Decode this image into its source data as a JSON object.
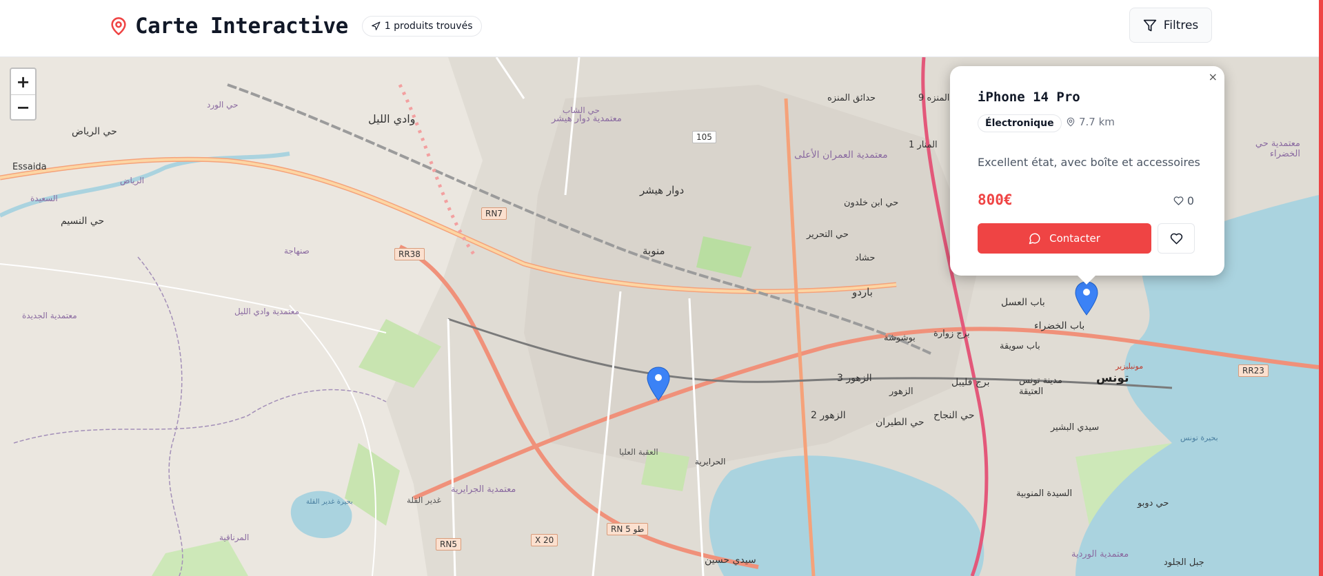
{
  "header": {
    "title": "Carte Interactive",
    "results_badge": "1 produits trouvés",
    "filters_label": "Filtres"
  },
  "map": {
    "zoom_in": "+",
    "zoom_out": "−",
    "place_labels": [
      {
        "text": "Essaida"
      },
      {
        "text": "حي الرياض"
      },
      {
        "text": "وادي الليل"
      },
      {
        "text": "الرياض"
      },
      {
        "text": "السعيدة"
      },
      {
        "text": "حي النسيم"
      },
      {
        "text": "صنهاجة"
      },
      {
        "text": "معتمدية الجديدة"
      },
      {
        "text": "معتمدية وادي الليل"
      },
      {
        "text": "دوار هيشر"
      },
      {
        "text": "معتمدية دوار هيشر"
      },
      {
        "text": "منوبة"
      },
      {
        "text": "العقبة العليا"
      },
      {
        "text": "الحرايرية"
      },
      {
        "text": "معتمدية الجرايرية"
      },
      {
        "text": "غدير القلة"
      },
      {
        "text": "بحيرة غدير القلة"
      },
      {
        "text": "المرناقية"
      },
      {
        "text": "سيدي حسين"
      },
      {
        "text": "حي الورد"
      },
      {
        "text": "حي الشاب"
      },
      {
        "text": "حدائق المنزه"
      },
      {
        "text": "المنزه 9"
      },
      {
        "text": "معتمدية العمران الأعلى"
      },
      {
        "text": "حي ابن خلدون"
      },
      {
        "text": "المنار 1"
      },
      {
        "text": "حي التحرير"
      },
      {
        "text": "حشاد"
      },
      {
        "text": "باردو"
      },
      {
        "text": "بوشوشة"
      },
      {
        "text": "برج زوارة"
      },
      {
        "text": "الزهور 3"
      },
      {
        "text": "الزهور"
      },
      {
        "text": "الزهور 2"
      },
      {
        "text": "برج فليبل"
      },
      {
        "text": "حي الطيران"
      },
      {
        "text": "حي النجاح"
      },
      {
        "text": "باب العسل"
      },
      {
        "text": "باب الخضراء"
      },
      {
        "text": "باب سويقة"
      },
      {
        "text": "مدينة تونس العتيقة"
      },
      {
        "text": "تونس"
      },
      {
        "text": "سيدي البشير"
      },
      {
        "text": "السيدة المنوبية"
      },
      {
        "text": "حي دوبو"
      },
      {
        "text": "معتمدية الوردية"
      },
      {
        "text": "جبل الجلود"
      },
      {
        "text": "بحيرة تونس"
      },
      {
        "text": "معتمدية حي الخضراء"
      },
      {
        "text": "مونبليزير"
      }
    ],
    "road_labels": [
      "RN7",
      "RR38",
      "105",
      "RR23",
      "RN5",
      "X 20",
      "RN 5 طو"
    ]
  },
  "popup": {
    "close": "×",
    "title": "iPhone 14 Pro",
    "category": "Électronique",
    "distance": "7.7 km",
    "description": "Excellent état, avec boîte et accessoires",
    "price": "800€",
    "likes": "0",
    "contact_label": "Contacter"
  },
  "colors": {
    "accent": "#ef4444",
    "marker": "#3b82f6",
    "water": "#aad3df",
    "map_bg": "#ebe7e0"
  }
}
